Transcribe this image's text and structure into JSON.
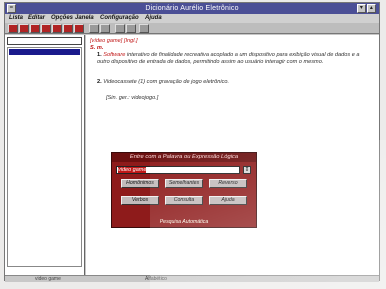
{
  "window": {
    "title": "Dicionário Aurélio Eletrônico"
  },
  "menu": [
    "Lista",
    "Editar",
    "Opções",
    "Janela",
    "Configuração",
    "Ajuda"
  ],
  "entry": {
    "headword": "[vídeo game] [Ingl.]",
    "class": "S. m.",
    "def1_num": "1.",
    "def1_lead": "Software",
    "def1_text": "interativo de finalidade recreativa acoplado a um dispositivo para exibição visual de dados e a outro dispositivo de entrada de dados, permitindo assim ao usuário interagir com o mesmo.",
    "def2_num": "2.",
    "def2_text": "Videocassete (1) com gravação de jogo eletrônico.",
    "synonym": "[Sin. ger.: videojogo.]"
  },
  "dialog": {
    "title": "Entre com a Palavra ou Expressão Lógica",
    "input_value": "video game",
    "dropdown_arrow": "⇕",
    "buttons": [
      "Homônimos",
      "Semelhantes",
      "Reverso",
      "Verbos",
      "Consulta",
      "Ajuda"
    ],
    "bottom_label": "Pesquisa Automática"
  },
  "status": {
    "left": "video game",
    "right": "Alfabético"
  },
  "colors": {
    "titlebar": "#4b4f96",
    "dialog": "#8e1b1b",
    "accent": "#c01818"
  }
}
